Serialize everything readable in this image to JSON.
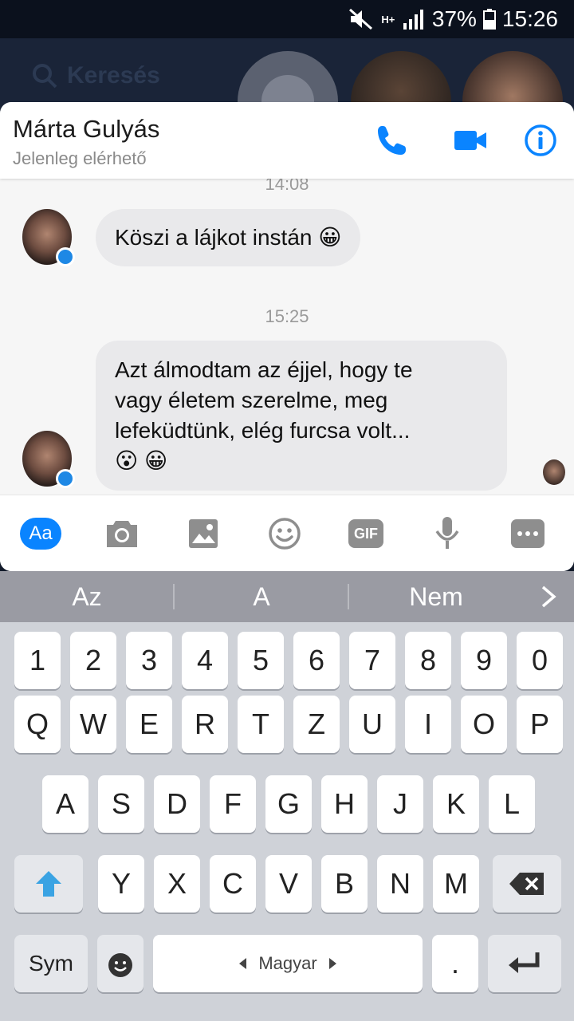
{
  "status_bar": {
    "battery": "37%",
    "time": "15:26",
    "network": "H+"
  },
  "background": {
    "search_placeholder": "Keresés"
  },
  "chat_header": {
    "contact_name": "Márta Gulyás",
    "presence": "Jelenleg elérhető",
    "icons": [
      "phone-icon",
      "video-camera-icon",
      "info-icon"
    ],
    "accent_color": "#0a84ff"
  },
  "messages": [
    {
      "time": "14:08",
      "text": "Köszi a lájkot instán 😀"
    },
    {
      "time": "15:25",
      "text_lines": [
        "Azt álmodtam az éjjel, hogy te",
        "vagy életem szerelme, meg",
        "lefeküdtünk, elég furcsa volt...",
        "😮 😀"
      ]
    }
  ],
  "composer": {
    "aa_label": "Aa",
    "gif_label": "GIF",
    "tools": [
      "aa-icon",
      "camera-icon",
      "gallery-icon",
      "emoji-icon",
      "gif-icon",
      "microphone-icon",
      "more-icon"
    ]
  },
  "keyboard": {
    "suggestions": [
      "Az",
      "A",
      "Nem"
    ],
    "row_numbers": [
      "1",
      "2",
      "3",
      "4",
      "5",
      "6",
      "7",
      "8",
      "9",
      "0"
    ],
    "row_1": [
      "Q",
      "W",
      "E",
      "R",
      "T",
      "Z",
      "U",
      "I",
      "O",
      "P"
    ],
    "row_2": [
      "A",
      "S",
      "D",
      "F",
      "G",
      "H",
      "J",
      "K",
      "L"
    ],
    "row_3": [
      "Y",
      "X",
      "C",
      "V",
      "B",
      "N",
      "M"
    ],
    "sym_label": "Sym",
    "space_label": "Magyar",
    "period_label": "."
  }
}
